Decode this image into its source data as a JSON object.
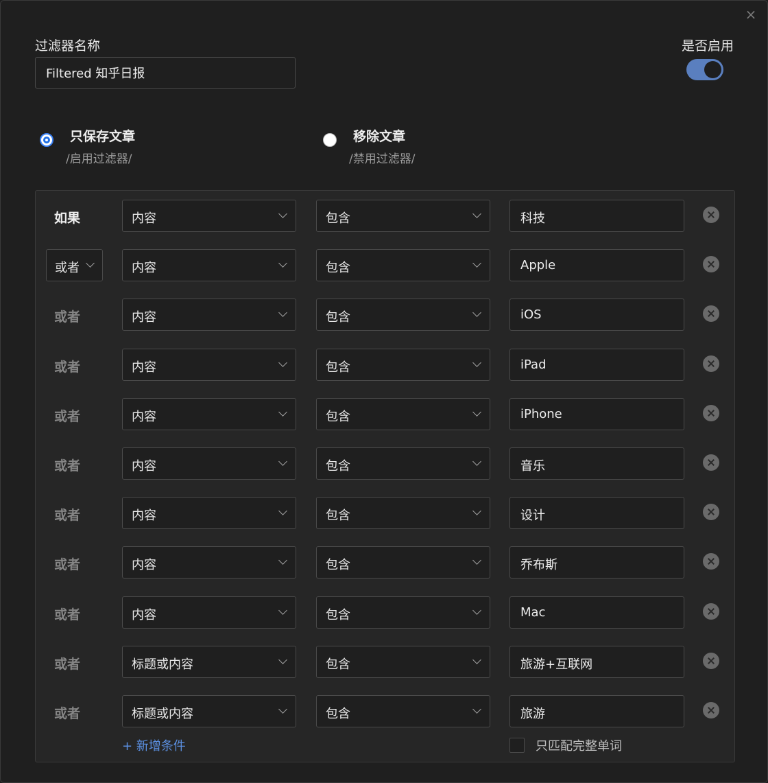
{
  "dialog": {
    "close_glyph": "×",
    "name_label": "过滤器名称",
    "name_value": "Filtered 知乎日报",
    "enable_label": "是否启用",
    "enabled": true
  },
  "mode": {
    "options": [
      {
        "title": "只保存文章",
        "subtitle": "/启用过滤器/",
        "checked": true
      },
      {
        "title": "移除文章",
        "subtitle": "/禁用过滤器/",
        "checked": false
      }
    ]
  },
  "rules": [
    {
      "logic": "如果",
      "field": "内容",
      "op": "包含",
      "value": "科技"
    },
    {
      "logic": "或者",
      "field": "内容",
      "op": "包含",
      "value": "Apple"
    },
    {
      "logic": "或者",
      "field": "内容",
      "op": "包含",
      "value": "iOS"
    },
    {
      "logic": "或者",
      "field": "内容",
      "op": "包含",
      "value": "iPad"
    },
    {
      "logic": "或者",
      "field": "内容",
      "op": "包含",
      "value": "iPhone"
    },
    {
      "logic": "或者",
      "field": "内容",
      "op": "包含",
      "value": "音乐"
    },
    {
      "logic": "或者",
      "field": "内容",
      "op": "包含",
      "value": "设计"
    },
    {
      "logic": "或者",
      "field": "内容",
      "op": "包含",
      "value": "乔布斯"
    },
    {
      "logic": "或者",
      "field": "内容",
      "op": "包含",
      "value": "Mac"
    },
    {
      "logic": "或者",
      "field": "标题或内容",
      "op": "包含",
      "value": "旅游+互联网"
    },
    {
      "logic": "或者",
      "field": "标题或内容",
      "op": "包含",
      "value": "旅游"
    }
  ],
  "footer": {
    "add_condition": "+ 新增条件",
    "whole_word_label": "只匹配完整单词",
    "whole_word_checked": false
  },
  "colors": {
    "accent": "#5a7fbf",
    "link": "#5b8fe0",
    "background": "#1f1f1f"
  }
}
